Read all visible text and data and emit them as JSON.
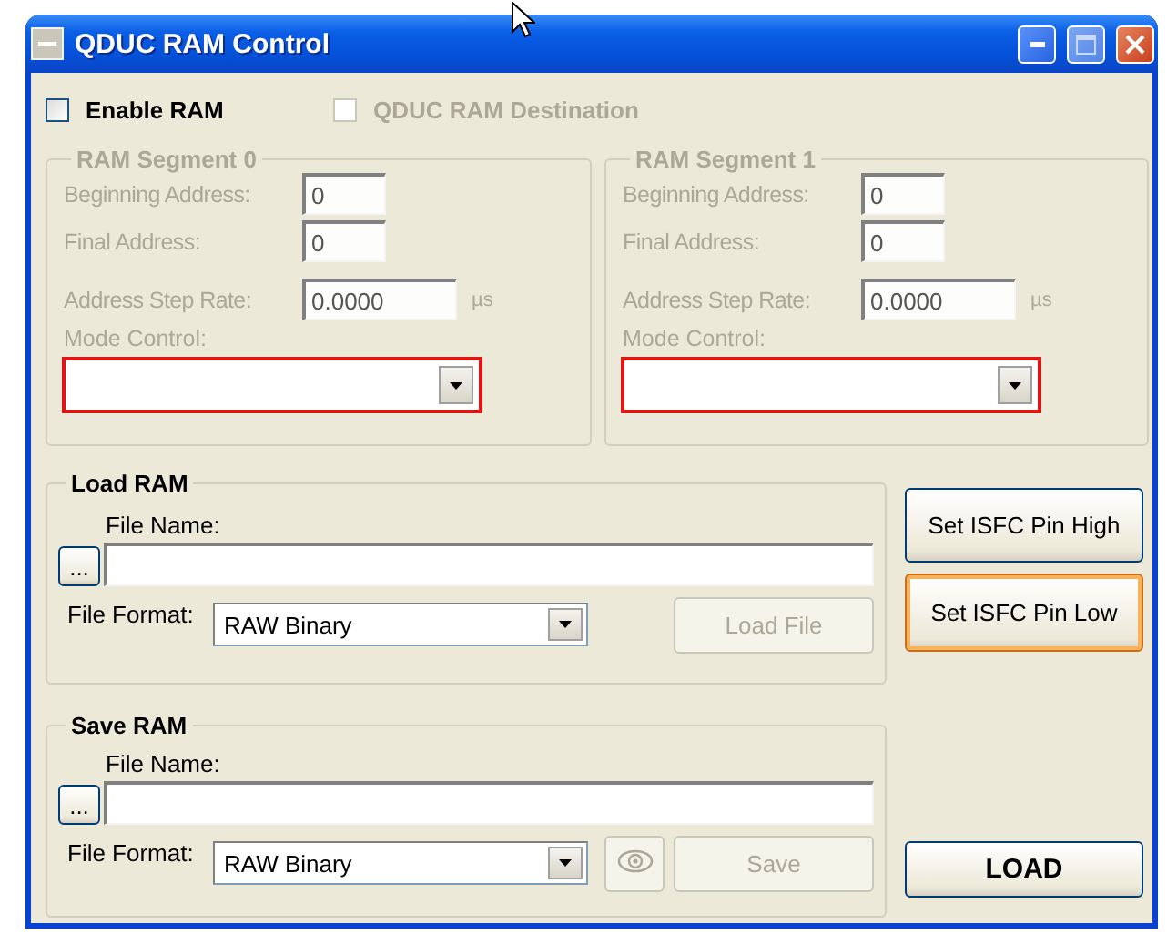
{
  "window": {
    "title": "QDUC RAM Control"
  },
  "options": [
    {
      "label": "Enable RAM",
      "checked": false,
      "disabled": false
    },
    {
      "label": "QDUC RAM Destination",
      "checked": false,
      "disabled": true
    }
  ],
  "segments": [
    {
      "title": "RAM Segment 0",
      "disabled": true,
      "fields": [
        {
          "label": "Beginning Address:",
          "value": "0"
        },
        {
          "label": "Final Address:",
          "value": "0"
        },
        {
          "label": "Address Step Rate:",
          "value": "0.0000",
          "unit": "µs"
        }
      ],
      "mode_label": "Mode Control:",
      "mode_flagged": true
    },
    {
      "title": "RAM Segment 1",
      "disabled": true,
      "fields": [
        {
          "label": "Beginning Address:",
          "value": "0"
        },
        {
          "label": "Final Address:",
          "value": "0"
        },
        {
          "label": "Address Step Rate:",
          "value": "0.0000",
          "unit": "µs"
        }
      ],
      "mode_label": "Mode Control:",
      "mode_flagged": true
    }
  ],
  "file_groups": [
    {
      "kind": "load",
      "title": "Load RAM",
      "browse": "...",
      "file_label": "File Name:",
      "format_label": "File Format:",
      "format": "RAW Binary",
      "action": {
        "label": "Load File",
        "disabled": true
      }
    },
    {
      "kind": "save",
      "title": "Save RAM",
      "browse": "...",
      "file_label": "File Name:",
      "format_label": "File Format:",
      "format": "RAW Binary",
      "preview_disabled": true,
      "action": {
        "label": "Save",
        "disabled": true
      }
    }
  ],
  "side_buttons": [
    {
      "label": "Set ISFC Pin High",
      "focused": false
    },
    {
      "label": "Set ISFC Pin Low",
      "focused": true
    }
  ],
  "load_button": {
    "label": "LOAD",
    "disabled": false
  }
}
